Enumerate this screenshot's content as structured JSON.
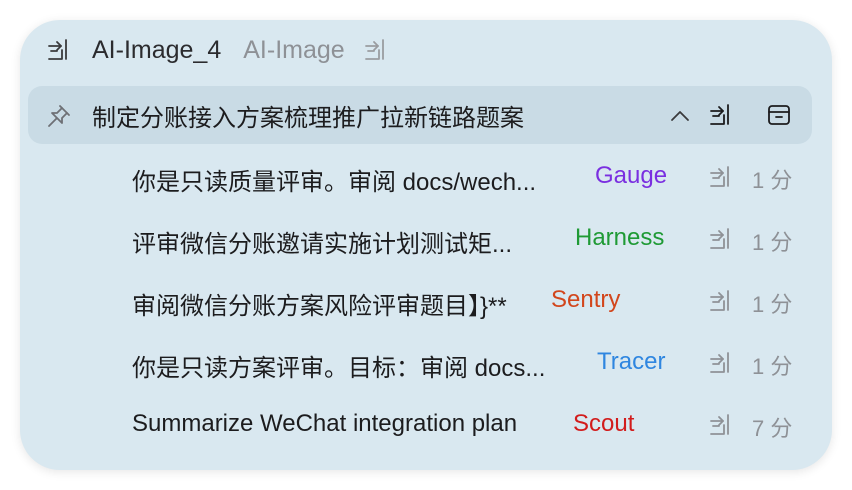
{
  "header": {
    "title": "AI-Image_4",
    "subtitle": "AI-Image",
    "open_icon": "open-in-window-icon"
  },
  "thread": {
    "title": "制定分账接入方案梳理推广拉新链路题案",
    "pin_icon": "pin-icon",
    "collapse_icon": "chevron-up-icon",
    "archive_icon": "archive-icon"
  },
  "subagents": [
    {
      "text": "你是只读质量评审。审阅 docs/wech...",
      "agent": "Gauge",
      "agent_color": "#7a2fe0",
      "time": "1 分"
    },
    {
      "text": "评审微信分账邀请实施计划测试矩...",
      "agent": "Harness",
      "agent_color": "#1f9a35",
      "time": "1 分"
    },
    {
      "text": "审阅微信分账方案风险评审题目】}**",
      "agent": "Sentry",
      "agent_color": "#d2461c",
      "time": "1 分"
    },
    {
      "text": "你是只读方案评审。目标：审阅 docs...",
      "agent": "Tracer",
      "agent_color": "#2f86e0",
      "time": "1 分"
    },
    {
      "text": "Summarize WeChat integration plan",
      "agent": "Scout",
      "agent_color": "#d21c1c",
      "time": "7 分"
    }
  ]
}
